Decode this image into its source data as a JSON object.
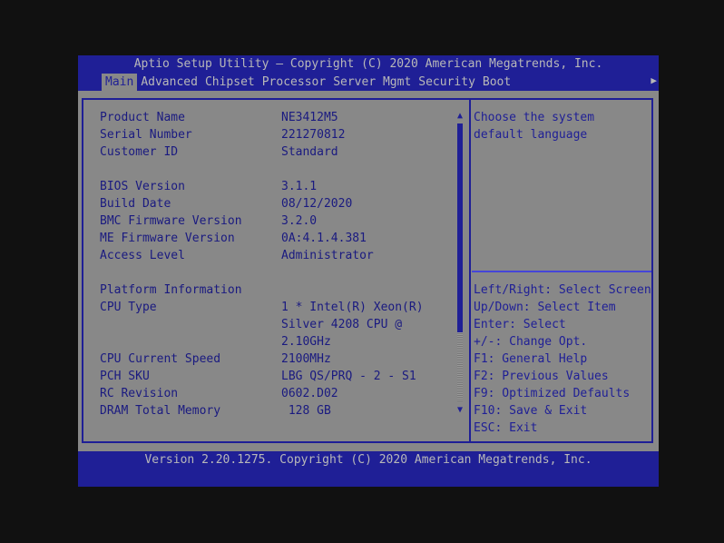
{
  "header": {
    "title": "Aptio Setup Utility – Copyright (C) 2020 American Megatrends, Inc.",
    "tabs": [
      {
        "label": "Main"
      },
      {
        "label": "Advanced"
      },
      {
        "label": "Chipset"
      },
      {
        "label": "Processor"
      },
      {
        "label": "Server Mgmt"
      },
      {
        "label": "Security"
      },
      {
        "label": "Boot"
      }
    ],
    "more_icon": "right-triangle-icon"
  },
  "items": [
    {
      "label": "Product Name",
      "value": "NE3412M5"
    },
    {
      "label": "Serial Number",
      "value": "221270812"
    },
    {
      "label": "Customer ID",
      "value": "Standard"
    },
    {
      "label": "BIOS Version",
      "value": "3.1.1"
    },
    {
      "label": "Build Date",
      "value": "08/12/2020"
    },
    {
      "label": "BMC Firmware Version",
      "value": "3.2.0"
    },
    {
      "label": "ME Firmware Version",
      "value": "0A:4.1.4.381"
    },
    {
      "label": "Access Level",
      "value": "Administrator"
    },
    {
      "label": "Platform Information",
      "value": ""
    },
    {
      "label": "CPU Type",
      "value": "1 * Intel(R) Xeon(R)"
    },
    {
      "label": "",
      "value": "Silver 4208 CPU @"
    },
    {
      "label": "",
      "value": "2.10GHz"
    },
    {
      "label": "CPU Current Speed",
      "value": "2100MHz"
    },
    {
      "label": "PCH SKU",
      "value": "LBG QS/PRQ - 2 - S1"
    },
    {
      "label": "RC Revision",
      "value": "0602.D02"
    },
    {
      "label": "DRAM Total Memory",
      "value": " 128 GB"
    }
  ],
  "scroll": {
    "position_fraction": 0,
    "visible_fraction": 0.75
  },
  "help": {
    "lines": [
      "Choose the system",
      "default language"
    ]
  },
  "keys": [
    "Left/Right: Select Screen",
    "Up/Down: Select Item",
    "Enter: Select",
    "+/-: Change Opt.",
    "F1: General Help",
    "F2: Previous Values",
    "F9: Optimized Defaults",
    "F10: Save & Exit",
    "ESC: Exit"
  ],
  "footer": "Version 2.20.1275. Copyright (C) 2020 American Megatrends, Inc."
}
